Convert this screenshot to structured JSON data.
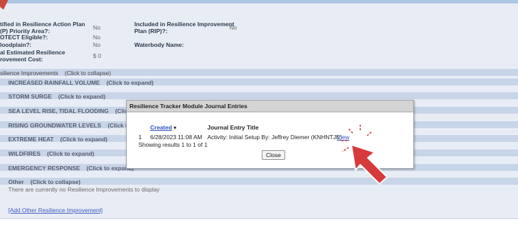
{
  "fields": {
    "priority_area_label": "tified in Resilience Action Plan\n(P) Priority Area?:",
    "priority_area_value": "No",
    "rip_label": "Included in Resilience Improvement\nPlan (RIP)?:",
    "rip_value": "No",
    "protect_label": "OTECT Eligible?:",
    "protect_value": "No",
    "floodplain_label": "loodplain?:",
    "floodplain_value": "No",
    "waterbody_label": "Waterbody Name:",
    "cost_label": "al Estimated Resilience\nrovement Cost:",
    "cost_value": "$ 0"
  },
  "sections": {
    "improvements_header": "silience Improvements    (Click to collapse)",
    "increased_rainfall": "INCREASED RAINFALL VOLUME    (Click to expand)",
    "storm_surge": "STORM SURGE    (Click to expand)",
    "sea_level": "SEA LEVEL RISE, TIDAL FLOODING    (Click t",
    "groundwater": "RISING GROUNDWATER LEVELS    (Click to e",
    "extreme_heat": "EXTREME HEAT    (Click to expand)",
    "wildfires": "WILDFIRES    (Click to expand)",
    "emergency": "EMERGENCY RESPONSE    (Click to expand)",
    "other": "Other    (Click to collapse)",
    "empty_message": "There are currently no Resilience Improvements to display",
    "add_other_link": "[Add Other Resilience Improvement]"
  },
  "modal": {
    "title": "Resilience Tracker Module Journal Entries",
    "col_created": "Created",
    "sort_indicator": "▾",
    "col_title": "Journal Entry Title",
    "rows": [
      {
        "num": "1",
        "created": "6/28/2023 11:08 AM",
        "title": "Activity: Initial Setup By: Jeffrey Diemer (KNHNTJE)",
        "view": "View"
      }
    ],
    "results_text": "Showing results 1 to 1 of 1",
    "close_label": "Close"
  },
  "colors": {
    "annotation_red": "#d63a3a",
    "link_blue": "#2a4fbf",
    "band_blue": "#c8d4e8",
    "panel_bg": "#e8edf5"
  },
  "icons": [
    "pointer-arrow-annotation",
    "click-burst-icon",
    "sort-caret-icon"
  ]
}
